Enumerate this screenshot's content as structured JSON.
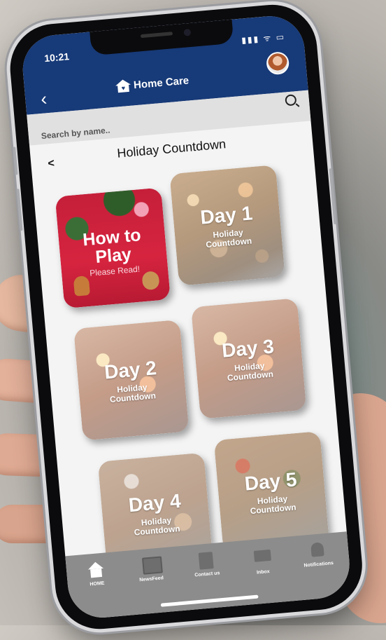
{
  "status": {
    "time": "10:21",
    "icons": "▮▮▮ ᯤ ▭"
  },
  "header": {
    "back_label": "‹",
    "brand": "Home Care"
  },
  "search": {
    "placeholder": "Search by name.."
  },
  "section": {
    "back_label": "<",
    "title": "Holiday Countdown"
  },
  "cards": [
    {
      "title_line1": "How to",
      "title_line2": "Play",
      "subtitle": "Please Read!"
    },
    {
      "title": "Day 1",
      "sub1": "Holiday",
      "sub2": "Countdown"
    },
    {
      "title": "Day 2",
      "sub1": "Holiday",
      "sub2": "Countdown"
    },
    {
      "title": "Day 3",
      "sub1": "Holiday",
      "sub2": "Countdown"
    },
    {
      "title": "Day 4",
      "sub1": "Holiday",
      "sub2": "Countdown"
    },
    {
      "title": "Day 5",
      "sub1": "Holiday",
      "sub2": "Countdown"
    }
  ],
  "tabs": [
    {
      "label": "HOME",
      "icon": "home-icon"
    },
    {
      "label": "NewsFeed",
      "icon": "newsfeed-icon"
    },
    {
      "label": "Contact us",
      "icon": "contact-icon"
    },
    {
      "label": "Inbox",
      "icon": "inbox-icon"
    },
    {
      "label": "Notifications",
      "icon": "bell-icon"
    }
  ],
  "colors": {
    "header": "#173a78",
    "tabbar": "#8c8c8c",
    "howto_card": "#c51f3a"
  }
}
